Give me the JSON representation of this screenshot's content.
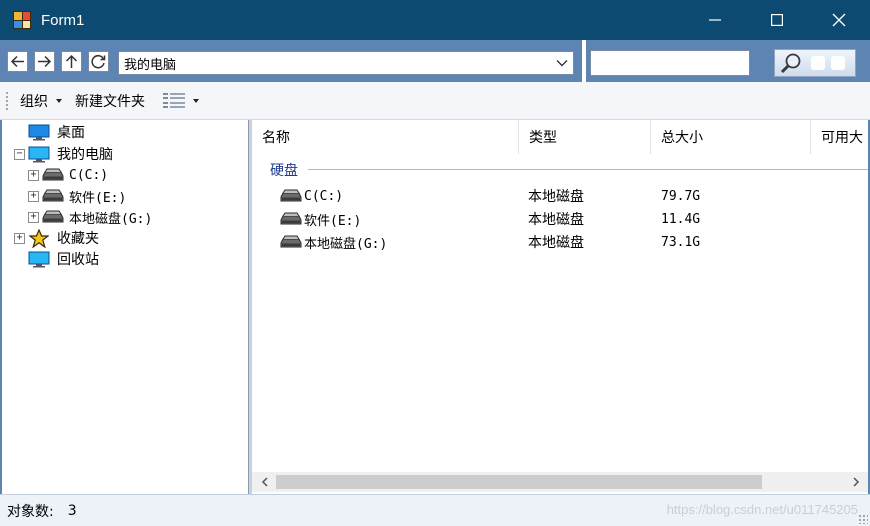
{
  "window": {
    "title": "Form1"
  },
  "address": {
    "path": "我的电脑",
    "search_value": ""
  },
  "toolbar": {
    "organize": "组织",
    "new_folder": "新建文件夹"
  },
  "tree": {
    "items": [
      {
        "label": "桌面",
        "icon": "desktop-icon",
        "expandable": false
      },
      {
        "label": "我的电脑",
        "icon": "computer-icon",
        "expandable": true,
        "expanded": true
      },
      {
        "label": "C(C:)",
        "icon": "drive-icon",
        "expandable": true,
        "expanded": false
      },
      {
        "label": "软件(E:)",
        "icon": "drive-icon",
        "expandable": true,
        "expanded": false
      },
      {
        "label": "本地磁盘(G:)",
        "icon": "drive-icon",
        "expandable": true,
        "expanded": false
      },
      {
        "label": "收藏夹",
        "icon": "star-icon",
        "expandable": true,
        "expanded": false
      },
      {
        "label": "回收站",
        "icon": "recycle-bin-icon",
        "expandable": false
      }
    ]
  },
  "list": {
    "columns": [
      "名称",
      "类型",
      "总大小",
      "可用大"
    ],
    "group": "硬盘",
    "rows": [
      {
        "name": "C(C:)",
        "type": "本地磁盘",
        "size": "79.7G"
      },
      {
        "name": "软件(E:)",
        "type": "本地磁盘",
        "size": "11.4G"
      },
      {
        "name": "本地磁盘(G:)",
        "type": "本地磁盘",
        "size": "73.1G"
      }
    ]
  },
  "status": {
    "label": "对象数:",
    "count": "3",
    "watermark": "https://blog.csdn.net/u011745205"
  },
  "colors": {
    "titlebar": "#0d4a72",
    "addressbar": "#5e84b4",
    "group_text": "#1f3a8a"
  }
}
